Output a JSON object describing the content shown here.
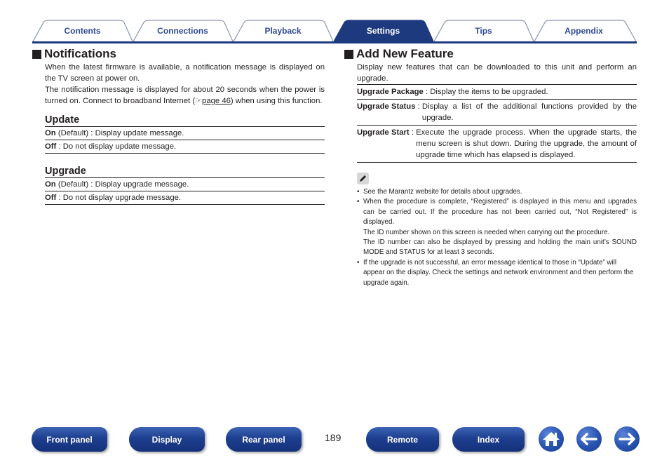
{
  "tabs": [
    {
      "label": "Contents",
      "active": false
    },
    {
      "label": "Connections",
      "active": false
    },
    {
      "label": "Playback",
      "active": false
    },
    {
      "label": "Settings",
      "active": true
    },
    {
      "label": "Tips",
      "active": false
    },
    {
      "label": "Appendix",
      "active": false
    }
  ],
  "notifications": {
    "title": "Notifications",
    "para1": "When the latest firmware is available, a notification message is displayed on the TV screen at power on.",
    "para2_before": "The notification message is displayed for about 20 seconds when the power is turned on. Connect to broadband Internet (",
    "para2_link": "page 46",
    "para2_after": ") when using this function.",
    "update": {
      "title": "Update",
      "rows": [
        {
          "key": "On",
          "rest": " (Default) : Display update message."
        },
        {
          "key": "Off",
          "rest": " : Do not display update message."
        }
      ]
    },
    "upgrade": {
      "title": "Upgrade",
      "rows": [
        {
          "key": "On",
          "rest": " (Default) : Display upgrade message."
        },
        {
          "key": "Off",
          "rest": " : Do not display upgrade message."
        }
      ]
    }
  },
  "add_new_feature": {
    "title": "Add New Feature",
    "intro": "Display new features that can be downloaded to this unit and perform an upgrade.",
    "items": [
      {
        "term": "Upgrade Package",
        "desc": "Display the items to be upgraded."
      },
      {
        "term": "Upgrade Status",
        "desc": "Display a list of the additional functions provided by the upgrade."
      },
      {
        "term": "Upgrade Start",
        "desc": "Execute the upgrade process. When the upgrade starts, the menu screen is shut down. During the upgrade, the amount of upgrade time which has elapsed is displayed."
      }
    ],
    "notes": {
      "icon": "pencil-icon",
      "bullet": "•",
      "n1": "See the Marantz website for details about upgrades.",
      "n2a": "When the procedure is complete, “Registered” is displayed in this menu and upgrades can be carried out. If the procedure has not been carried out, “Not Registered” is displayed.",
      "n2b": "The ID number shown on this screen is needed when carrying out the procedure.",
      "n2c": "The ID number can also be displayed by pressing and holding the main unit’s SOUND MODE and STATUS for at least 3 seconds.",
      "n3": "If the upgrade is not successful, an error message identical to those in “Update” will appear on the display. Check the settings and network environment and then perform the upgrade again."
    }
  },
  "footer": {
    "buttons": [
      "Front panel",
      "Display",
      "Rear panel",
      "Remote",
      "Index"
    ],
    "page_number": "189",
    "icons": [
      "home-icon",
      "back-arrow-icon",
      "forward-arrow-icon"
    ]
  },
  "colors": {
    "brand": "#1d3a7e",
    "tab_text": "#2f4a95"
  }
}
